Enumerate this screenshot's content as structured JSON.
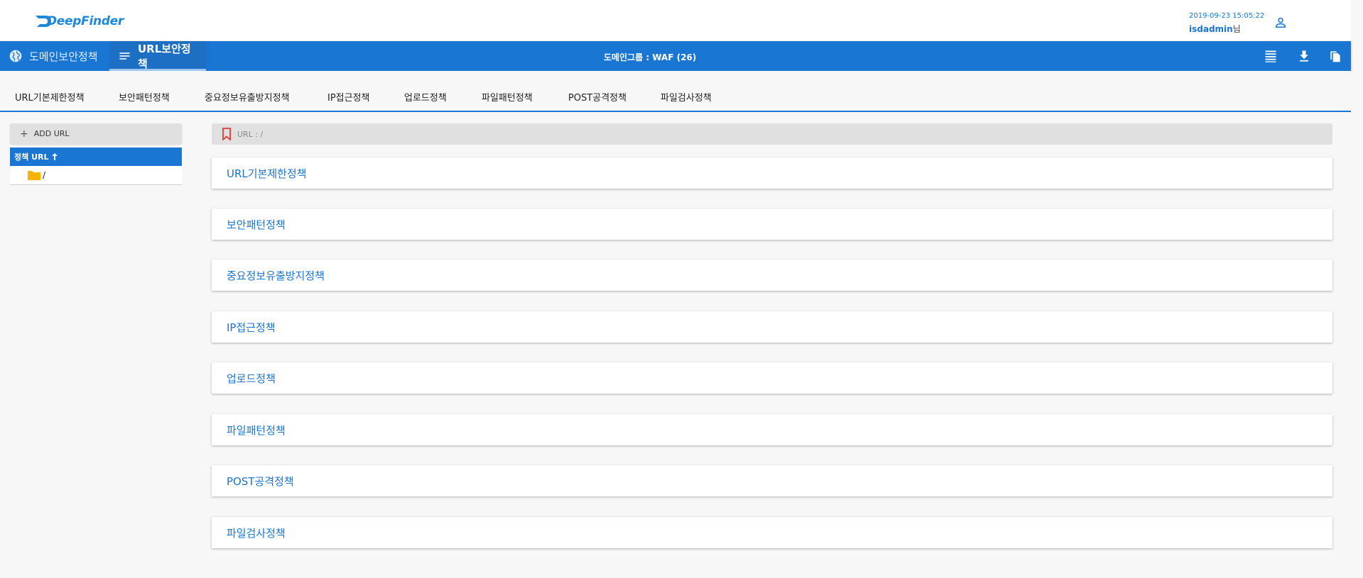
{
  "header": {
    "logo_text": "DeepFinder",
    "timestamp": "2019-09-23 15:05:22",
    "username": "isdadmin",
    "username_suffix": "님",
    "user_icon": "account-icon"
  },
  "navbar": {
    "tabs": [
      {
        "label": "도메인보안정책",
        "icon": "globe-icon",
        "active": false
      },
      {
        "label": "URL보안정책",
        "icon": "list-icon",
        "active": true
      }
    ],
    "domain_group": "도메인그룹 : WAF (26)",
    "actions": [
      "table-view-icon",
      "download-icon",
      "copy-icon"
    ]
  },
  "subtabs": [
    "URL기본제한정책",
    "보안패턴정책",
    "중요정보유출방지정책",
    "IP접근정책",
    "업로드정책",
    "파일패턴정책",
    "POST공격정책",
    "파일검사정책"
  ],
  "sidebar": {
    "add_button": "ADD URL",
    "tree_header": "정책 URL",
    "tree_items": [
      {
        "label": "/"
      }
    ]
  },
  "main": {
    "breadcrumb": "URL : /",
    "panels": [
      "URL기본제한정책",
      "보안패턴정책",
      "중요정보유출방지정책",
      "IP접근정책",
      "업로드정책",
      "파일패턴정책",
      "POST공격정책",
      "파일검사정책"
    ]
  },
  "colors": {
    "primary": "#1976d2",
    "background": "#f7f7f7",
    "folder": "#f5b400",
    "bookmark": "#e53935"
  }
}
